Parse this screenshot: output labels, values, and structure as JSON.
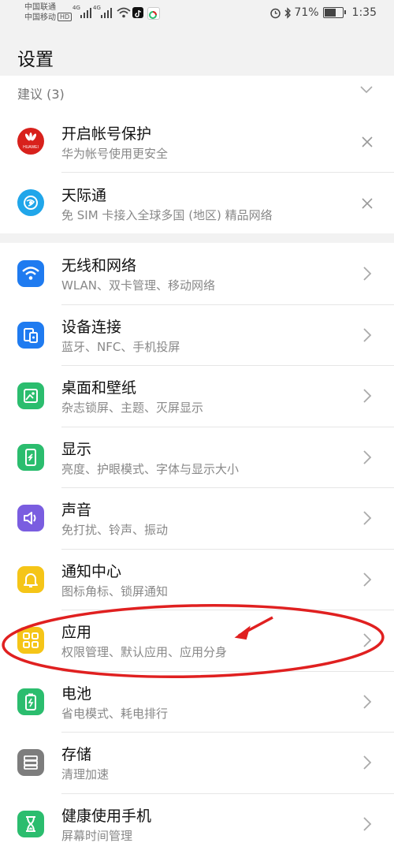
{
  "status_bar": {
    "carrier1": "中国联通",
    "carrier2": "中国移动",
    "hd": "HD",
    "net1": "4G",
    "net2": "4G",
    "battery_pct": "71%",
    "battery_level": 0.71,
    "time": "1:35"
  },
  "page": {
    "title": "设置"
  },
  "suggestions": {
    "header": "建议 (3)",
    "items": [
      {
        "title": "开启帐号保护",
        "subtitle": "华为帐号使用更安全",
        "icon": "huawei-logo-icon",
        "logo_text": "HUAWEI",
        "color": "#d8211c"
      },
      {
        "title": "天际通",
        "subtitle": "免 SIM 卡接入全球多国 (地区) 精品网络",
        "icon": "skytone-icon",
        "color": "#20a6ea"
      }
    ]
  },
  "settings": {
    "items": [
      {
        "title": "无线和网络",
        "subtitle": "WLAN、双卡管理、移动网络",
        "icon": "wifi-icon",
        "color": "#1f7bf0"
      },
      {
        "title": "设备连接",
        "subtitle": "蓝牙、NFC、手机投屏",
        "icon": "device-connect-icon",
        "color": "#1f7bf0"
      },
      {
        "title": "桌面和壁纸",
        "subtitle": "杂志锁屏、主题、灭屏显示",
        "icon": "wallpaper-icon",
        "color": "#2bbd6e"
      },
      {
        "title": "显示",
        "subtitle": "亮度、护眼模式、字体与显示大小",
        "icon": "display-icon",
        "color": "#2bbd6e"
      },
      {
        "title": "声音",
        "subtitle": "免打扰、铃声、振动",
        "icon": "sound-icon",
        "color": "#7a5de0"
      },
      {
        "title": "通知中心",
        "subtitle": "图标角标、锁屏通知",
        "icon": "bell-icon",
        "color": "#f5c518"
      },
      {
        "title": "应用",
        "subtitle": "权限管理、默认应用、应用分身",
        "icon": "apps-grid-icon",
        "color": "#f5c518"
      },
      {
        "title": "电池",
        "subtitle": "省电模式、耗电排行",
        "icon": "battery-icon",
        "color": "#2bbd6e"
      },
      {
        "title": "存储",
        "subtitle": "清理加速",
        "icon": "storage-icon",
        "color": "#7d7d7d"
      },
      {
        "title": "健康使用手机",
        "subtitle": "屏幕时间管理",
        "icon": "hourglass-icon",
        "color": "#2bbd6e"
      }
    ]
  },
  "annotation": {
    "color": "#e02020",
    "target": "应用"
  }
}
